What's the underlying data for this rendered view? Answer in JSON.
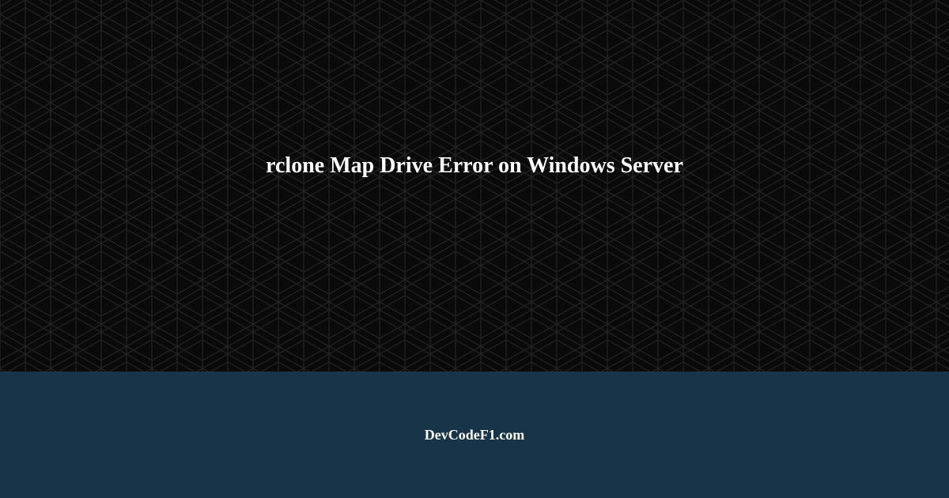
{
  "hero": {
    "title": "rclone Map Drive Error on Windows Server"
  },
  "footer": {
    "site_name": "DevCodeF1.com"
  },
  "colors": {
    "hero_bg": "#0a0a0a",
    "footer_bg": "#173449",
    "text": "#ffffff"
  }
}
